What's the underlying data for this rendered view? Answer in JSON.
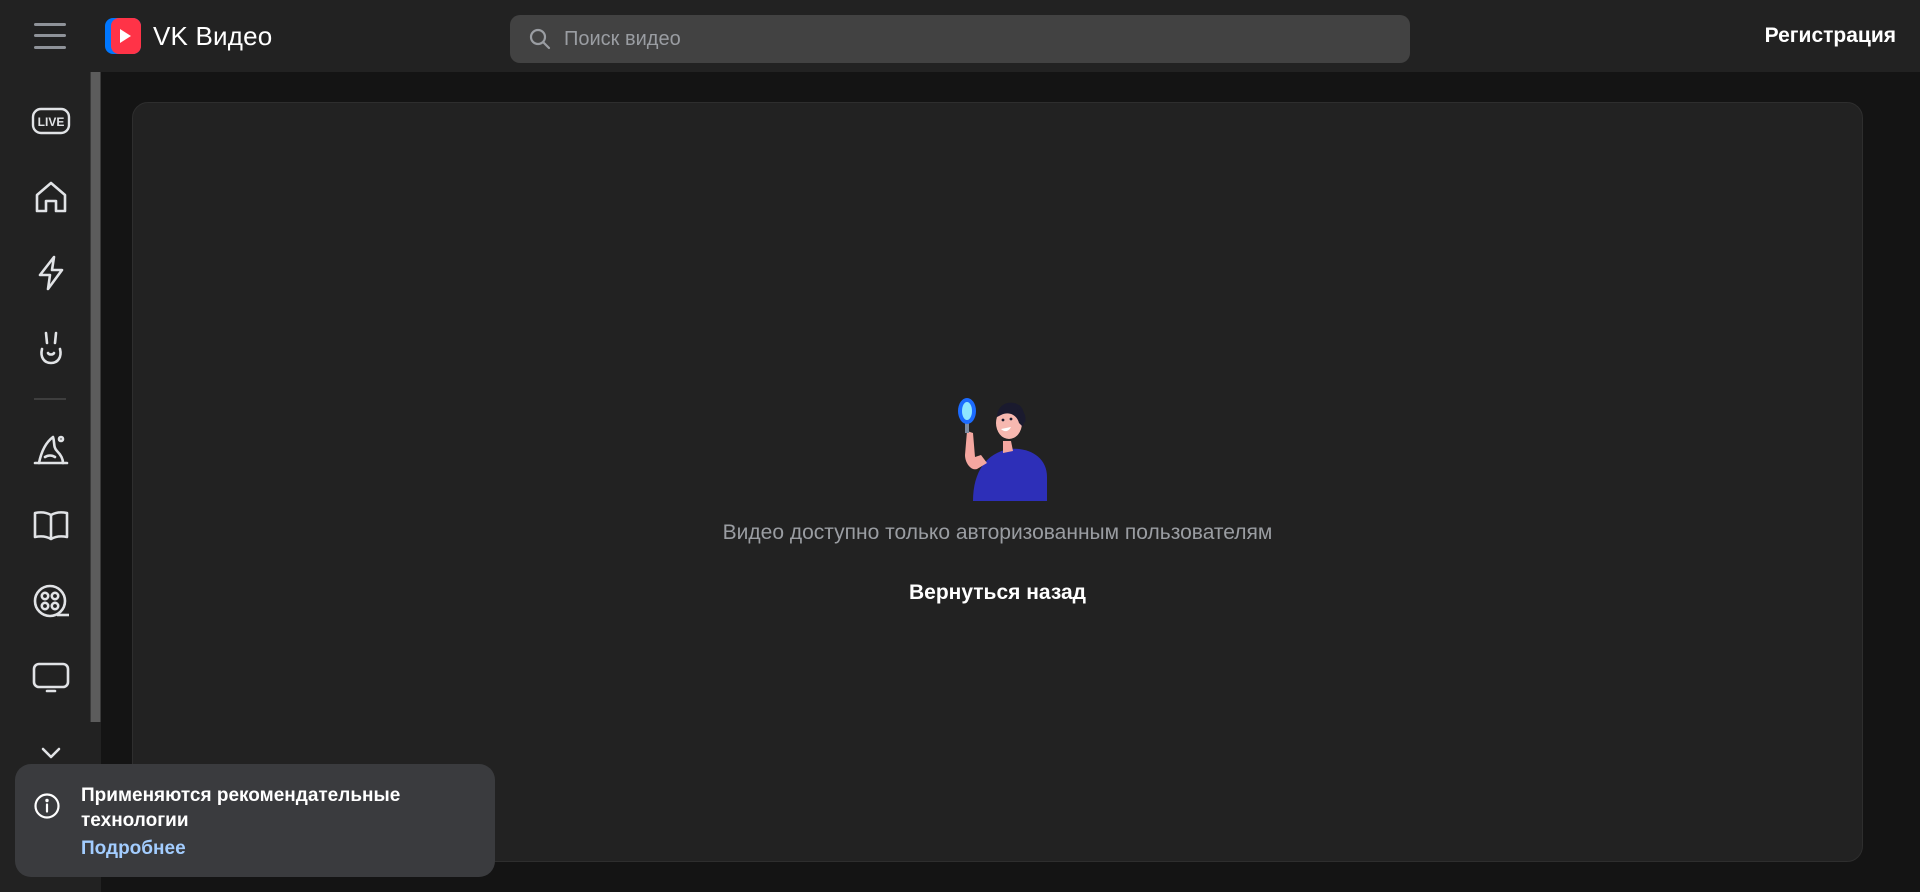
{
  "header": {
    "brand": "VK Видео",
    "search_placeholder": "Поиск видео",
    "register_label": "Регистрация"
  },
  "sidebar": {
    "items": [
      {
        "icon": "live-icon"
      },
      {
        "icon": "home-icon"
      },
      {
        "icon": "lightning-icon"
      },
      {
        "icon": "kids-bunny-icon"
      },
      {
        "icon": "wizard-hat-icon"
      },
      {
        "icon": "book-icon"
      },
      {
        "icon": "film-reel-icon"
      },
      {
        "icon": "tv-icon"
      },
      {
        "icon": "chevron-down-icon"
      }
    ]
  },
  "main": {
    "message": "Видео доступно только авторизованным пользователям",
    "back_label": "Вернуться назад"
  },
  "toast": {
    "title": "Применяются рекомендательные технологии",
    "link": "Подробнее"
  },
  "colors": {
    "background": "#141414",
    "panel": "#222222",
    "search": "#424242",
    "link": "#a3cdff",
    "logo_red": "#ff3347",
    "logo_blue": "#0077ff"
  }
}
